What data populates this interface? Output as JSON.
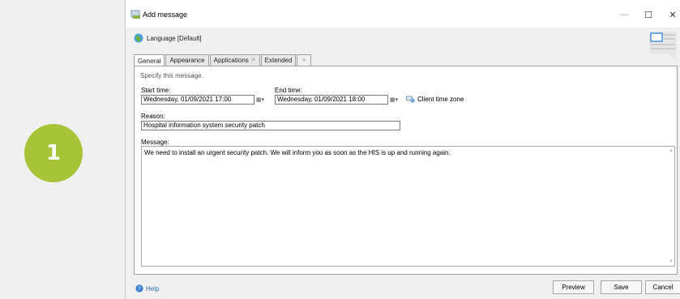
{
  "step": {
    "number": "1",
    "color": "#a7c439"
  },
  "window": {
    "title": "Add message",
    "controls": {
      "minimize": "—",
      "maximize": "☐",
      "close": "✕"
    }
  },
  "language": {
    "label": "Language [Default]",
    "icon": "globe-icon"
  },
  "tabs": [
    {
      "label": "General",
      "active": true
    },
    {
      "label": "Appearance",
      "active": false
    },
    {
      "label": "Applications",
      "active": false,
      "closable": true
    },
    {
      "label": "Extended",
      "active": false
    },
    {
      "label": "+",
      "active": false
    }
  ],
  "form": {
    "instruction": "Specify this message.",
    "start_time": {
      "label": "Start time:",
      "value": "Wednesday, 01/09/2021  17:00"
    },
    "end_time": {
      "label": "End time:",
      "value": "Wednesday, 01/09/2021  18:00"
    },
    "client_time_zone": "Client time zone",
    "reason": {
      "label": "Reason:",
      "value": "Hospital information system security patch"
    },
    "message": {
      "label": "Message:",
      "value": "We need to install an urgent security patch. We will inform you as soon as the HIS is up and running again."
    }
  },
  "footer": {
    "help": "Help",
    "preview": "Preview",
    "save": "Save",
    "cancel": "Cancel"
  },
  "colors": {
    "accent": "#a7c439",
    "link": "#3a6fb0"
  }
}
